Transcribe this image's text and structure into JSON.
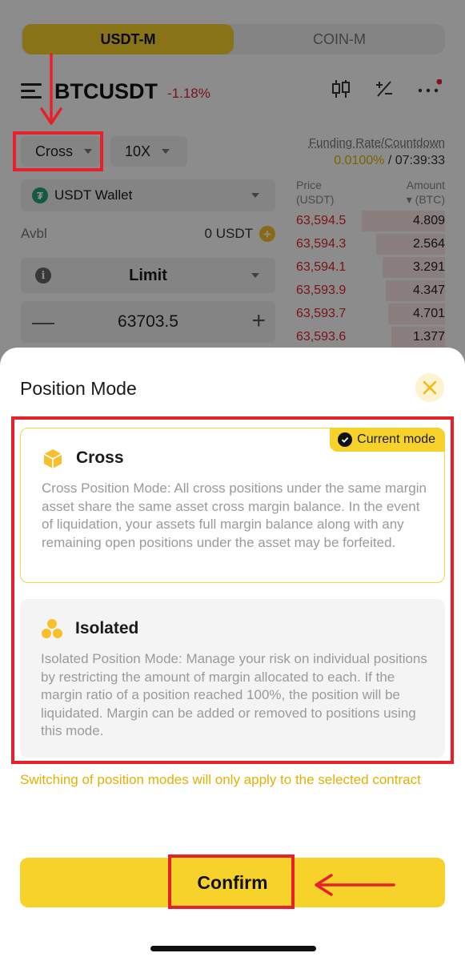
{
  "market_tabs": {
    "active": "USDT-M",
    "inactive": "COIN-M"
  },
  "header": {
    "symbol": "BTCUSDT",
    "change": "-1.18%"
  },
  "controls": {
    "margin_mode": "Cross",
    "leverage": "10X"
  },
  "funding": {
    "label": "Funding Rate/Countdown",
    "rate": "0.0100%",
    "separator": " / ",
    "countdown": "07:39:33"
  },
  "wallet": {
    "label": "USDT Wallet"
  },
  "avbl": {
    "label": "Avbl",
    "value": "0 USDT"
  },
  "order": {
    "type": "Limit",
    "price": "63703.5"
  },
  "orderbook": {
    "price_header": "Price",
    "price_unit": "(USDT)",
    "amount_header": "Amount",
    "amount_unit": "▾ (BTC)",
    "rows": [
      {
        "price": "63,594.5",
        "amount": "4.809",
        "depth": 0.56
      },
      {
        "price": "63,594.3",
        "amount": "2.564",
        "depth": 0.46
      },
      {
        "price": "63,594.1",
        "amount": "3.291",
        "depth": 0.42
      },
      {
        "price": "63,593.9",
        "amount": "4.347",
        "depth": 0.4
      },
      {
        "price": "63,593.7",
        "amount": "4.701",
        "depth": 0.38
      },
      {
        "price": "63,593.6",
        "amount": "1.377",
        "depth": 0.36
      }
    ]
  },
  "sheet": {
    "title": "Position Mode",
    "current_badge": "Current mode",
    "cross": {
      "title": "Cross",
      "description": "Cross Position Mode: All cross positions under the same margin asset share the same asset cross margin balance. In the event of liquidation, your assets full margin balance along with any remaining open positions under the asset may be forfeited."
    },
    "isolated": {
      "title": "Isolated",
      "description": "Isolated Position Mode: Manage your risk on individual positions by restricting the amount of margin allocated to each. If the margin ratio of a position reached 100%, the position will be liquidated. Margin can be added or removed to positions using this mode."
    },
    "note": "Switching of position modes will only apply to the selected contract",
    "confirm_label": "Confirm"
  },
  "colors": {
    "accent": "#f7d22b",
    "annotation": "#e8202a",
    "negative": "#e0242f"
  }
}
